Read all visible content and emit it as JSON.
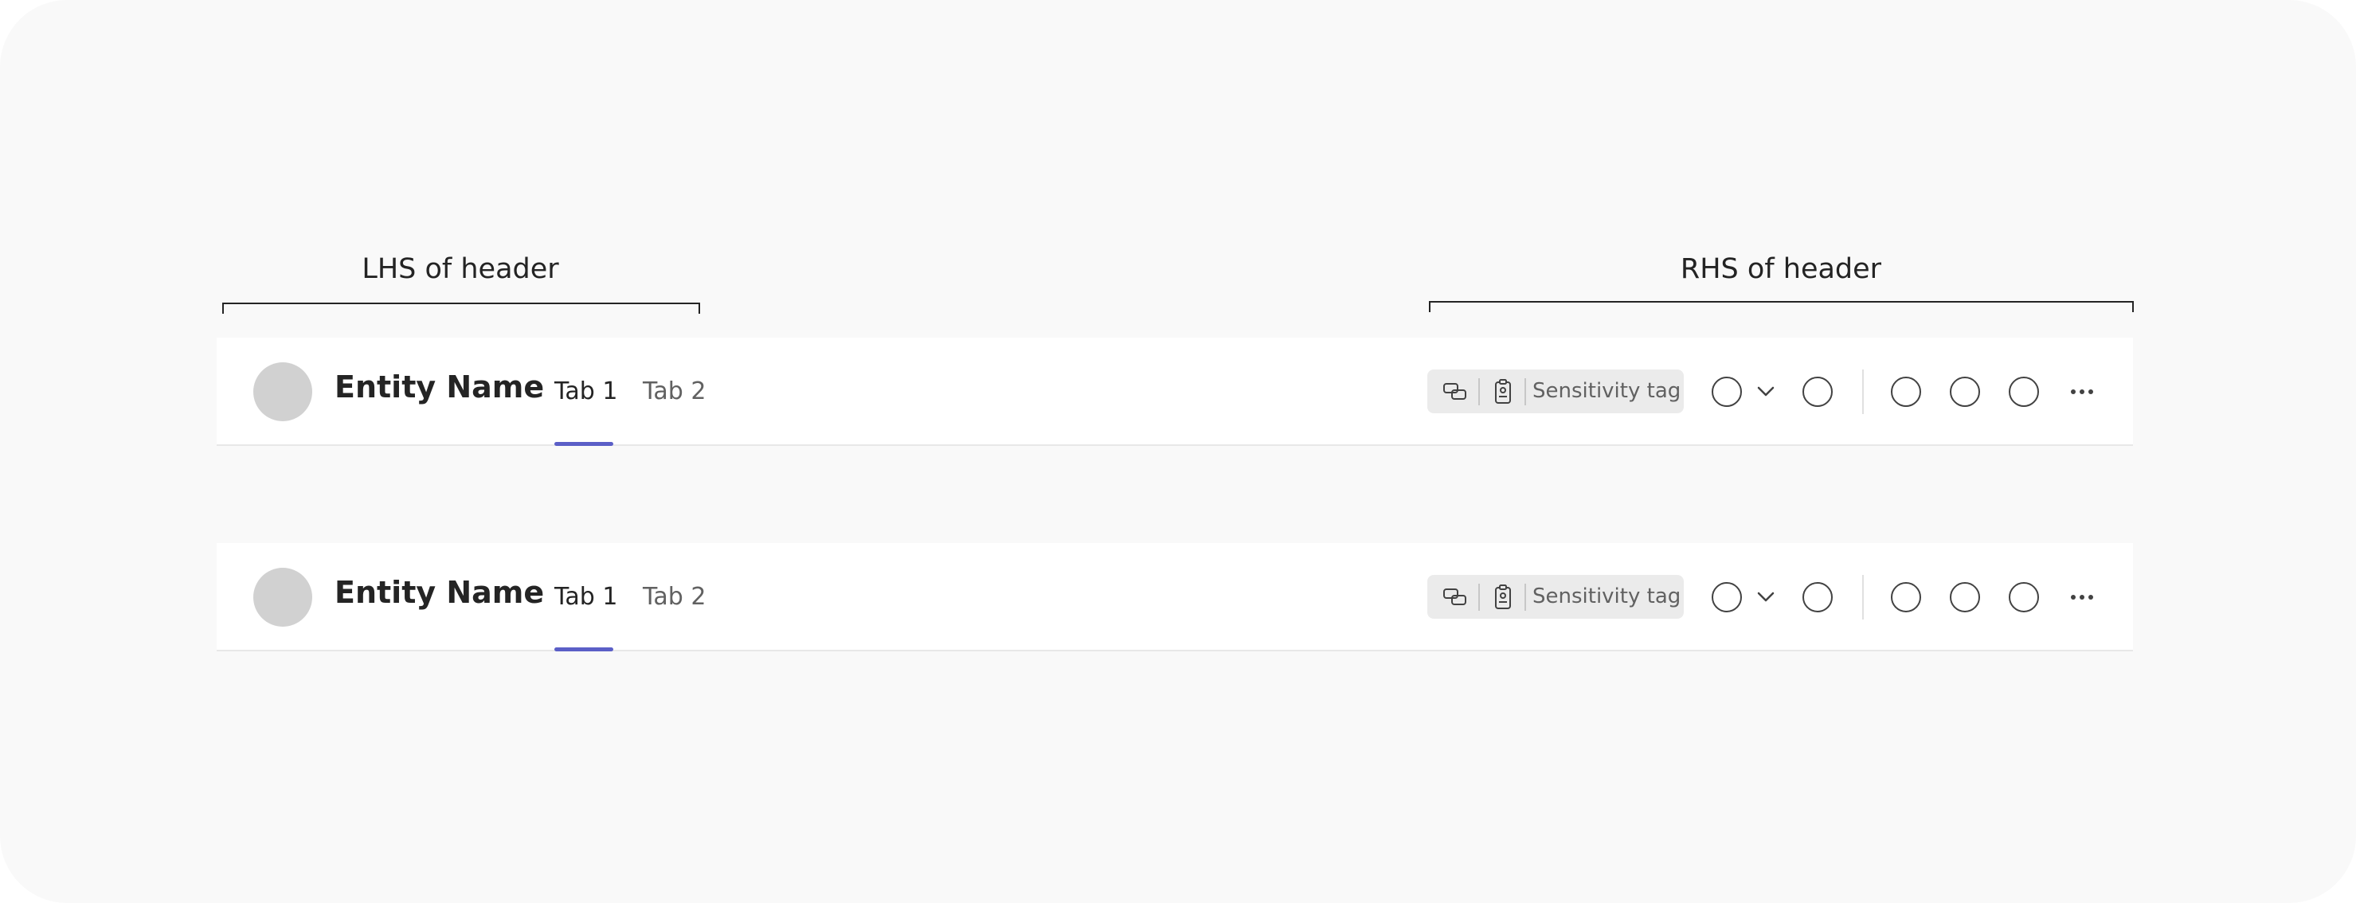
{
  "annotations": {
    "lhs_label": "LHS of header",
    "rhs_label": "RHS of header"
  },
  "headers": [
    {
      "entity_name": "Entity Name",
      "tabs": [
        {
          "label": "Tab 1",
          "active": true
        },
        {
          "label": "Tab 2",
          "active": false
        }
      ],
      "sensitivity_tag": "Sensitivity tag"
    },
    {
      "entity_name": "Entity Name",
      "tabs": [
        {
          "label": "Tab 1",
          "active": true
        },
        {
          "label": "Tab 2",
          "active": false
        }
      ],
      "sensitivity_tag": "Sensitivity tag"
    }
  ],
  "colors": {
    "accent": "#5b5fc7",
    "avatar": "#d1d1d1",
    "tag_background": "#ebebeb",
    "canvas": "#f9f9f9",
    "text_primary": "#242424",
    "text_secondary": "#616161"
  },
  "icons": {
    "tag_icon_1": "link-share-icon",
    "tag_icon_2": "clipboard-badge-icon",
    "more": "more-horizontal-icon",
    "chevron": "chevron-down-icon"
  }
}
